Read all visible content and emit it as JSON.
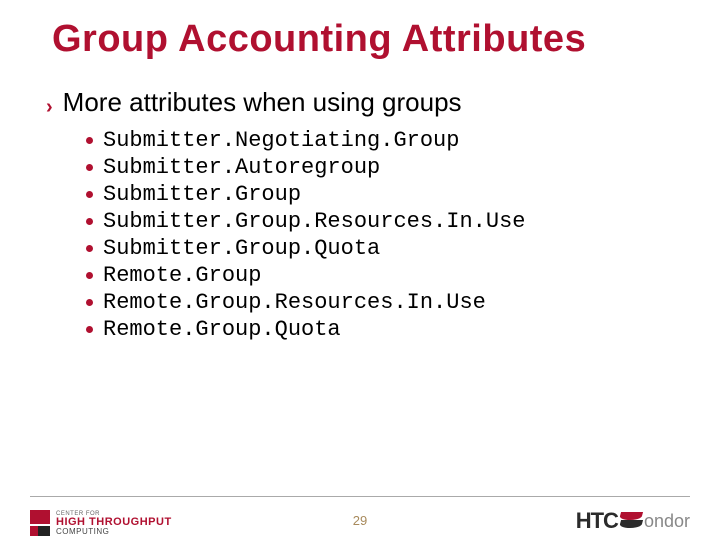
{
  "title": "Group Accounting Attributes",
  "intro": "More attributes when using groups",
  "attributes": [
    "Submitter.Negotiating.Group",
    "Submitter.Autoregroup",
    "Submitter.Group",
    "Submitter.Group.Resources.In.Use",
    "Submitter.Group.Quota",
    "Remote.Group",
    "Remote.Group.Resources.In.Use",
    "Remote.Group.Quota"
  ],
  "page_number": "29",
  "footer_left": {
    "line1": "CENTER FOR",
    "line2": "HIGH THROUGHPUT",
    "line3": "COMPUTING"
  },
  "footer_right": {
    "part1": "HTC",
    "part2": "ondor"
  }
}
